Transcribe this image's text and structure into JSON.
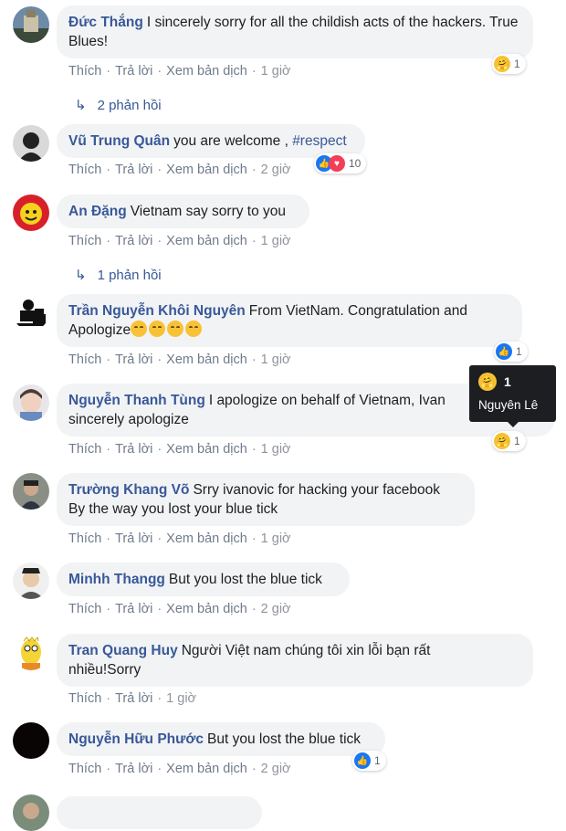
{
  "comments": [
    {
      "name": "Đức Thắng",
      "text": "I sincerely sorry for all the childish acts of the hackers. True Blues!",
      "actions": [
        "Thích",
        "Trả lời",
        "Xem bản dịch"
      ],
      "time": "1 giờ",
      "reaction_count": "1"
    },
    {
      "name": "Vũ Trung Quân",
      "text": "you are welcome , ",
      "hashtag": "#respect",
      "actions": [
        "Thích",
        "Trả lời",
        "Xem bản dịch"
      ],
      "time": "2 giờ",
      "reaction_count": "10"
    },
    {
      "name": "An Đặng",
      "text": "Vietnam say sorry to you",
      "actions": [
        "Thích",
        "Trả lời",
        "Xem bản dịch"
      ],
      "time": "1 giờ"
    },
    {
      "name": "Trần Nguyễn Khôi Nguyên",
      "text": "From VietNam. Congratulation and Apologize",
      "actions": [
        "Thích",
        "Trả lời",
        "Xem bản dịch"
      ],
      "time": "1 giờ",
      "reaction_count": "1"
    },
    {
      "name": "Nguyễn Thanh Tùng",
      "text": "I apologize on behalf of Vietnam, Ivan",
      "text2": "sincerely apologize",
      "actions": [
        "Thích",
        "Trả lời",
        "Xem bản dịch"
      ],
      "time": "1 giờ",
      "reaction_count": "1"
    },
    {
      "name": "Trường Khang Võ",
      "text": "Srry ivanovic for hacking your facebook",
      "text2": "By the way you lost your blue tick",
      "actions": [
        "Thích",
        "Trả lời",
        "Xem bản dịch"
      ],
      "time": "1 giờ"
    },
    {
      "name": "Minhh Thangg",
      "text": "But you lost the blue tick",
      "actions": [
        "Thích",
        "Trả lời",
        "Xem bản dịch"
      ],
      "time": "2 giờ"
    },
    {
      "name": "Tran Quang Huy",
      "text": "Người Việt nam chúng tôi xin lỗi bạn rất",
      "text2": "nhiều!Sorry",
      "actions": [
        "Thích",
        "Trả lời"
      ],
      "time": "1 giờ"
    },
    {
      "name": "Nguyễn Hữu Phước",
      "text": "But you lost the blue tick",
      "actions": [
        "Thích",
        "Trả lời",
        "Xem bản dịch"
      ],
      "time": "2 giờ",
      "reaction_count": "1"
    }
  ],
  "replies": [
    {
      "label": "2 phản hồi"
    },
    {
      "label": "1 phản hồi"
    }
  ],
  "tooltip": {
    "count": "1",
    "name": "Nguyên Lê"
  },
  "colors": {
    "name": "#385898",
    "bubble": "#f2f3f5",
    "like": "#1877f2",
    "love": "#f33e58",
    "haha": "#f7c236"
  }
}
